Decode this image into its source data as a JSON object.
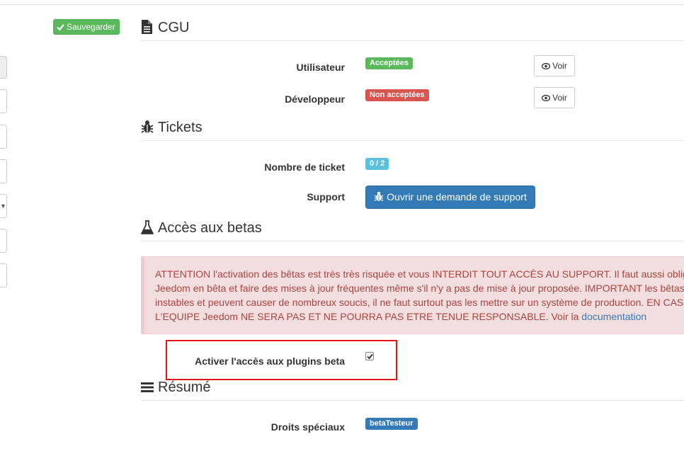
{
  "toolbar": {
    "save_label": "Sauvegarder"
  },
  "cgu": {
    "title": "CGU",
    "rows": [
      {
        "label": "Utilisateur",
        "status": "Acceptées",
        "button": "Voir"
      },
      {
        "label": "Développeur",
        "status": "Non acceptées",
        "button": "Voir"
      }
    ]
  },
  "tickets": {
    "title": "Tickets",
    "count_label": "Nombre de ticket",
    "count_value": "0 / 2",
    "support_label": "Support",
    "support_button": "Ouvrir une demande de support"
  },
  "betas": {
    "title": "Accès aux betas",
    "warning_lines": [
      "ATTENTION l'activation des bêtas est très très risquée et vous INTERDIT TOUT ACCÈS AU SUPPORT. Il faut aussi obligatoirement",
      "Jeedom en bêta et faire des mises à jour fréquentes même s'il n'y a pas de mise à jour proposée. IMPORTANT les bêtas",
      "instables et peuvent causer de nombreux soucis, il ne faut surtout pas les mettre sur un système de production. EN CAS",
      "L'EQUIPE Jeedom NE SERA PAS ET NE POURRA PAS ETRE TENUE RESPONSABLE. Voir la "
    ],
    "doc_link": "documentation",
    "plugin_beta_label": "Activer l'accès aux plugins beta",
    "plugin_beta_checked": true
  },
  "resume": {
    "title": "Résumé",
    "rights_label": "Droits spéciaux",
    "rights_value": "betaTesteur"
  },
  "colors": {
    "success": "#5cb85c",
    "danger": "#d9534f",
    "info": "#5bc0de",
    "primary": "#337ab7",
    "alert_bg": "#f2dede",
    "alert_text": "#a94442",
    "highlight": "#e31414"
  }
}
